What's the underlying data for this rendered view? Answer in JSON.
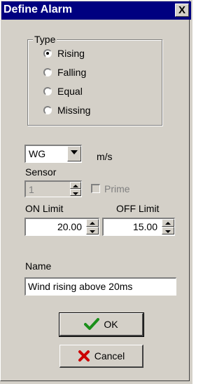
{
  "window": {
    "title": "Define Alarm",
    "close_label": "X"
  },
  "type_group": {
    "legend": "Type",
    "options": [
      {
        "label": "Rising",
        "selected": true
      },
      {
        "label": "Falling",
        "selected": false
      },
      {
        "label": "Equal",
        "selected": false
      },
      {
        "label": "Missing",
        "selected": false
      }
    ]
  },
  "variable": {
    "value": "WG",
    "unit": "m/s"
  },
  "sensor": {
    "label": "Sensor",
    "value": "1",
    "prime_label": "Prime",
    "prime_checked": false
  },
  "limits": {
    "on_label": "ON Limit",
    "on_value": "20.00",
    "off_label": "OFF Limit",
    "off_value": "15.00"
  },
  "name": {
    "label": "Name",
    "value": "Wind rising above 20ms"
  },
  "buttons": {
    "ok_label": "OK",
    "cancel_label": "Cancel"
  },
  "colors": {
    "titlebar": "#000080",
    "face": "#d4d0c8",
    "ok_check": "#1a8f1a",
    "cancel_x": "#cc0000"
  }
}
